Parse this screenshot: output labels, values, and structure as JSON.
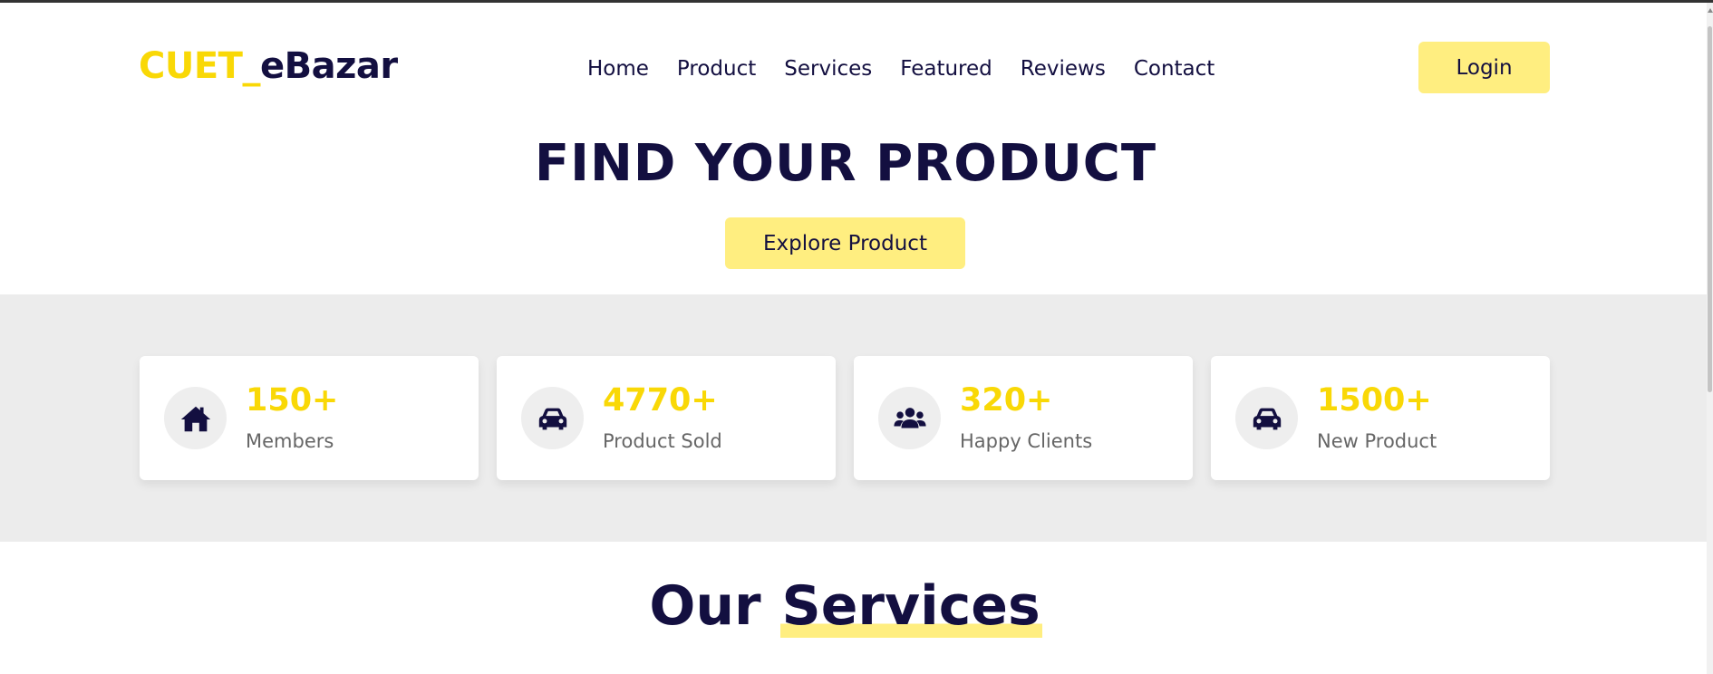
{
  "logo": {
    "accent": "CUET_",
    "main": "eBazar"
  },
  "nav": {
    "items": [
      {
        "label": "Home"
      },
      {
        "label": "Product"
      },
      {
        "label": "Services"
      },
      {
        "label": "Featured"
      },
      {
        "label": "Reviews"
      },
      {
        "label": "Contact"
      }
    ]
  },
  "header": {
    "login_label": "Login"
  },
  "hero": {
    "title": "FIND YOUR PRODUCT",
    "button_label": "Explore Product"
  },
  "stats": [
    {
      "icon": "home-icon",
      "value": "150+",
      "label": "Members"
    },
    {
      "icon": "car-icon",
      "value": "4770+",
      "label": "Product Sold"
    },
    {
      "icon": "users-icon",
      "value": "320+",
      "label": "Happy Clients"
    },
    {
      "icon": "car-icon",
      "value": "1500+",
      "label": "New Product"
    }
  ],
  "services": {
    "title_plain": "Our",
    "title_highlight": "Services"
  },
  "colors": {
    "accent": "#f9d806",
    "button": "#ffee80",
    "text_dark": "#130f40",
    "band": "#ececec"
  }
}
